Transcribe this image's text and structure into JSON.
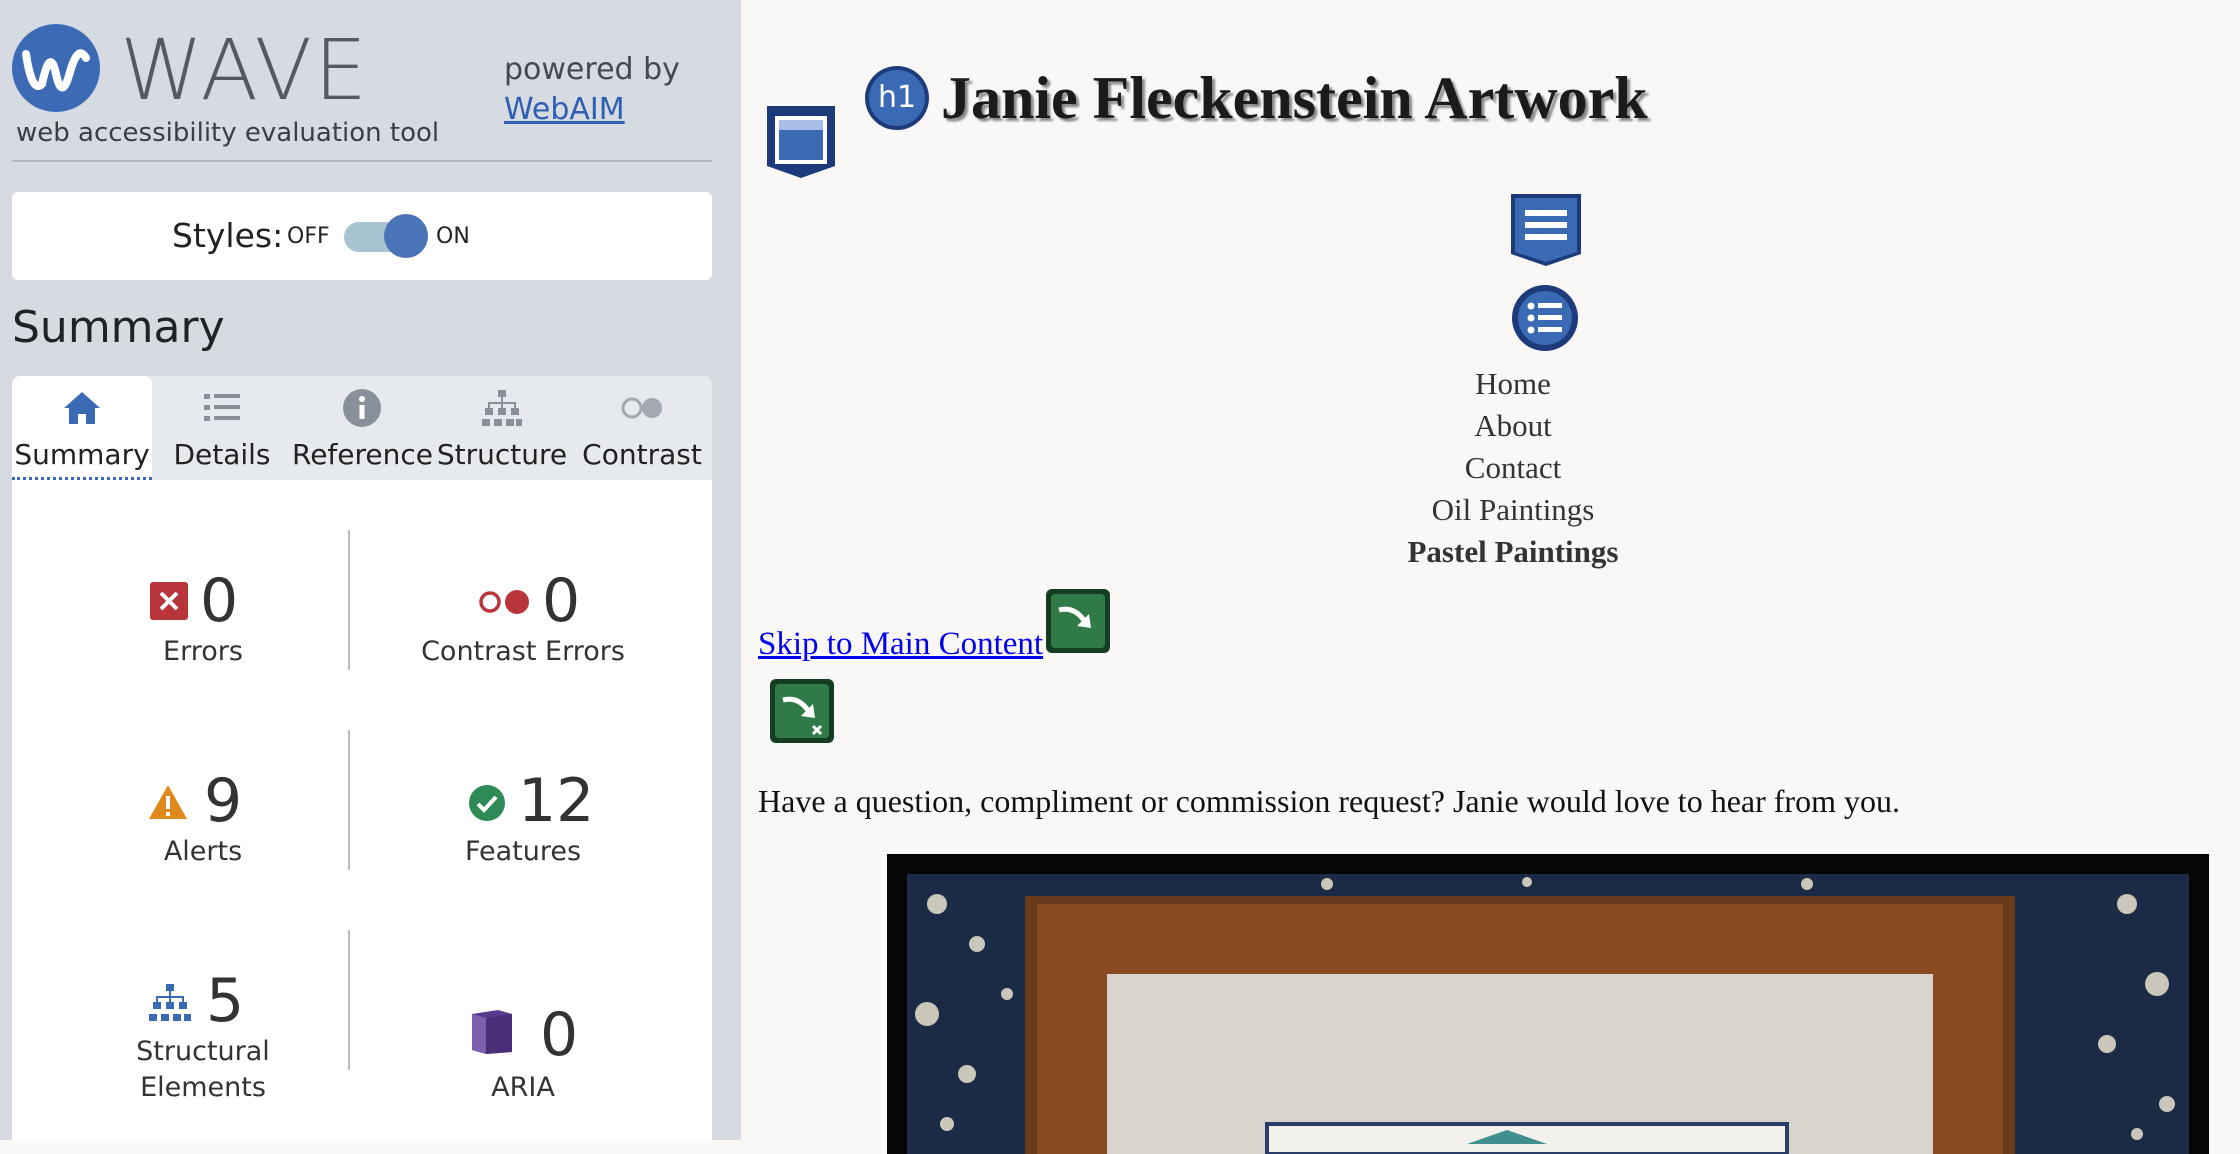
{
  "wave": {
    "brand": "WAVE",
    "subtitle": "web accessibility evaluation tool",
    "powered_by": "powered by",
    "webaim_link": "WebAIM",
    "styles_label": "Styles:",
    "toggle_off": "OFF",
    "toggle_on": "ON",
    "summary_heading": "Summary",
    "tabs": [
      {
        "label": "Summary",
        "icon": "home-icon",
        "active": true
      },
      {
        "label": "Details",
        "icon": "list-icon",
        "active": false
      },
      {
        "label": "Reference",
        "icon": "info-icon",
        "active": false
      },
      {
        "label": "Structure",
        "icon": "hierarchy-icon",
        "active": false
      },
      {
        "label": "Contrast",
        "icon": "contrast-icon",
        "active": false
      }
    ],
    "stats": {
      "errors": {
        "count": "0",
        "label": "Errors"
      },
      "contrast_errors": {
        "count": "0",
        "label": "Contrast Errors"
      },
      "alerts": {
        "count": "9",
        "label": "Alerts"
      },
      "features": {
        "count": "12",
        "label": "Features"
      },
      "structural": {
        "count": "5",
        "label_line1": "Structural",
        "label_line2": "Elements"
      },
      "aria": {
        "count": "0",
        "label": "ARIA"
      }
    },
    "colors": {
      "accent": "#3c6ab5",
      "error": "#b8353b",
      "alert": "#e08a1e",
      "feature": "#2e8b57",
      "aria": "#5a3a8c"
    }
  },
  "page": {
    "h1_badge": "h1",
    "title": "Janie Fleckenstein Artwork",
    "nav": [
      "Home",
      "About",
      "Contact",
      "Oil Paintings",
      "Pastel Paintings"
    ],
    "skip_link": "Skip to Main Content",
    "intro": "Have a question, compliment or commission request? Janie would love to hear from you."
  }
}
